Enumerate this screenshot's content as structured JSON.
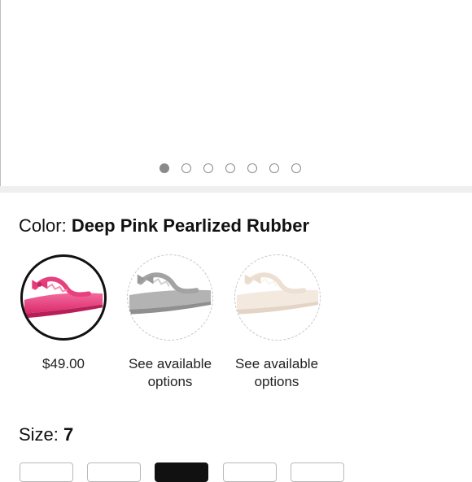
{
  "gallery": {
    "dot_count": 7,
    "active_index": 0
  },
  "color": {
    "label": "Color:",
    "selected_name": "Deep Pink Pearlized Rubber",
    "swatches": [
      {
        "caption": "$49.00",
        "tint": "#e8407f",
        "selected": true
      },
      {
        "caption": "See available options",
        "tint": "#a9a9a9",
        "selected": false
      },
      {
        "caption": "See available options",
        "tint": "#efe3d6",
        "selected": false
      }
    ]
  },
  "size": {
    "label": "Size:",
    "selected_value": "7",
    "buttons": [
      {
        "selected": false
      },
      {
        "selected": false
      },
      {
        "selected": true
      },
      {
        "selected": false
      },
      {
        "selected": false
      }
    ]
  },
  "colors": {
    "accent_dark": "#111111",
    "dot_gray": "#8a8a8a",
    "divider": "#efefef"
  }
}
